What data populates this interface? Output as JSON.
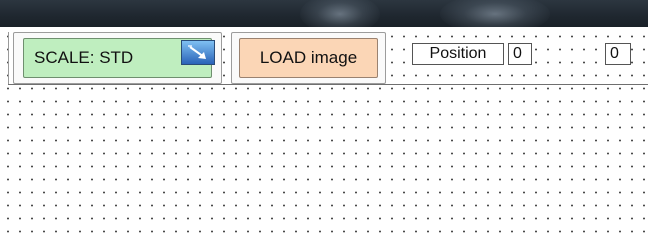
{
  "toolbar": {
    "scale_button_label": "SCALE: STD",
    "scale_icon": "resize-diagonal-icon",
    "load_button_label": "LOAD image",
    "position_label": "Position",
    "position_x_value": "0",
    "position_y_value": "0"
  },
  "colors": {
    "scale_button_bg": "#bfeebf",
    "load_button_bg": "#fbd6b6",
    "title_bar_bg": "#1f272f"
  }
}
